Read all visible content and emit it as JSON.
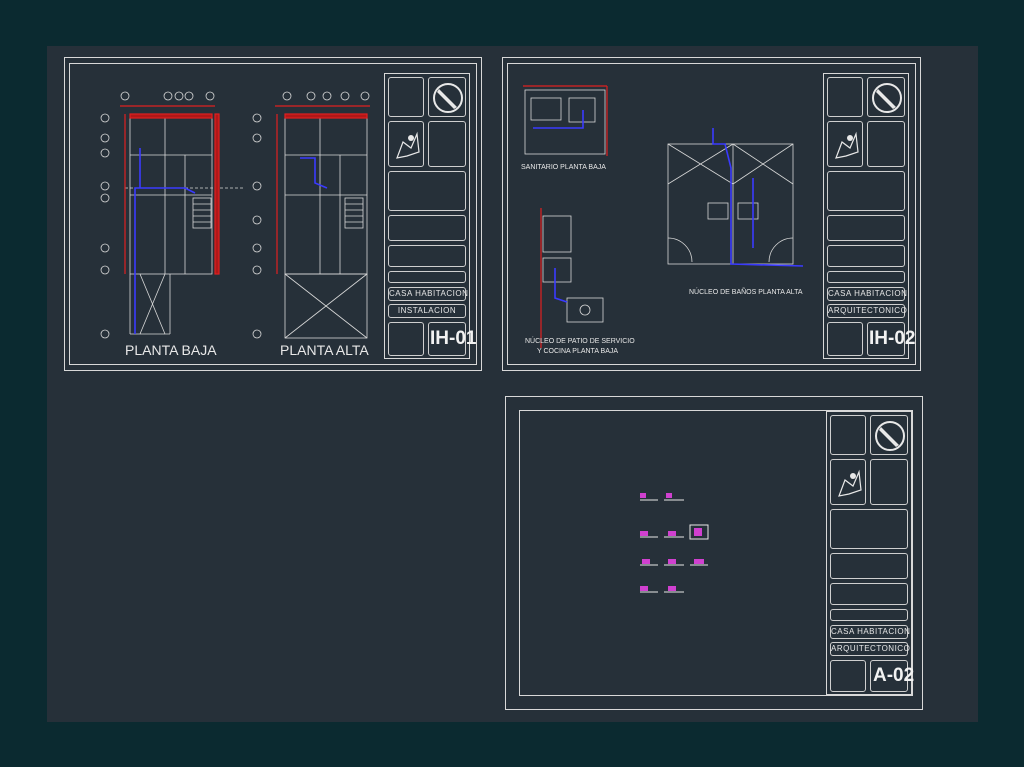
{
  "colors": {
    "outer_background": "#0b2a30",
    "model_space": "#263039",
    "linework": "#d8d8d8",
    "water_line_blue": "#3a3aff",
    "walls_red": "#e02020",
    "hatch_magenta": "#d040d0"
  },
  "sheets": [
    {
      "id": "IH-01",
      "code": "IH-01",
      "project": "CASA HABITACION",
      "discipline": "INSTALACION",
      "plans": [
        "PLANTA BAJA",
        "PLANTA ALTA"
      ]
    },
    {
      "id": "IH-02",
      "code": "IH-02",
      "project": "CASA HABITACION",
      "discipline": "ARQUITECTONICO",
      "plans": [
        "SANITARIO PLANTA BAJA",
        "NÚCLEO DE BAÑOS PLANTA ALTA",
        "NÚCLEO DE PATIO DE SERVICIO",
        "Y COCINA PLANTA BAJA"
      ]
    },
    {
      "id": "A-02",
      "code": "A-02",
      "project": "CASA HABITACION",
      "discipline": "ARQUITECTONICO",
      "plans": []
    }
  ],
  "icons": {
    "north": "compass-north-icon",
    "logo": "university-logo-icon"
  }
}
